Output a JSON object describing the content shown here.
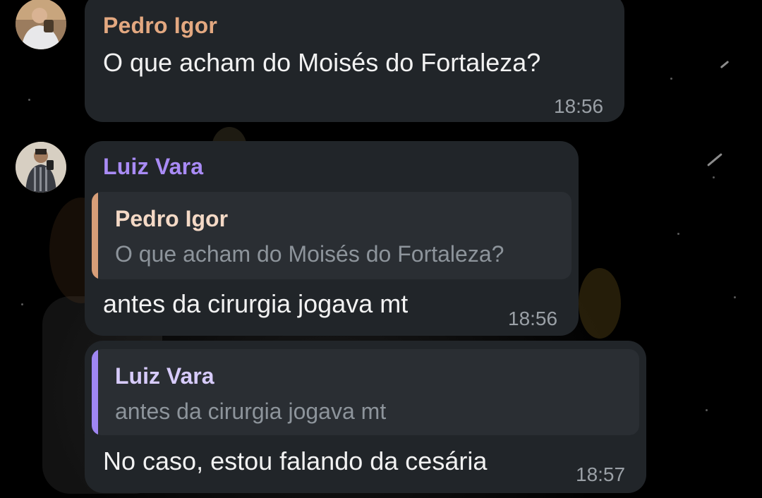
{
  "colors": {
    "bubble_bg": "#212529",
    "quote_bg": "#2a2e33",
    "pedro_name": "#e3a880",
    "luiz_name": "#a98bf5",
    "pedro_quote_name": "#f4d9c6",
    "luiz_quote_name": "#d7cbfb",
    "pedro_bar": "#d79e78",
    "luiz_bar": "#9f86f2"
  },
  "messages": [
    {
      "sender": "Pedro Igor",
      "text": "O que acham do Moisés do Fortaleza?",
      "time": "18:56",
      "avatar_icon": "user-avatar-icon"
    },
    {
      "sender": "Luiz Vara",
      "reply": {
        "name": "Pedro Igor",
        "text": "O que acham do Moisés do Fortaleza?"
      },
      "text": "antes da cirurgia jogava mt",
      "time": "18:56",
      "avatar_icon": "user-avatar-icon"
    },
    {
      "reply": {
        "name": "Luiz Vara",
        "text": "antes da cirurgia jogava mt"
      },
      "text": "No caso, estou falando da cesária",
      "time": "18:57"
    }
  ]
}
